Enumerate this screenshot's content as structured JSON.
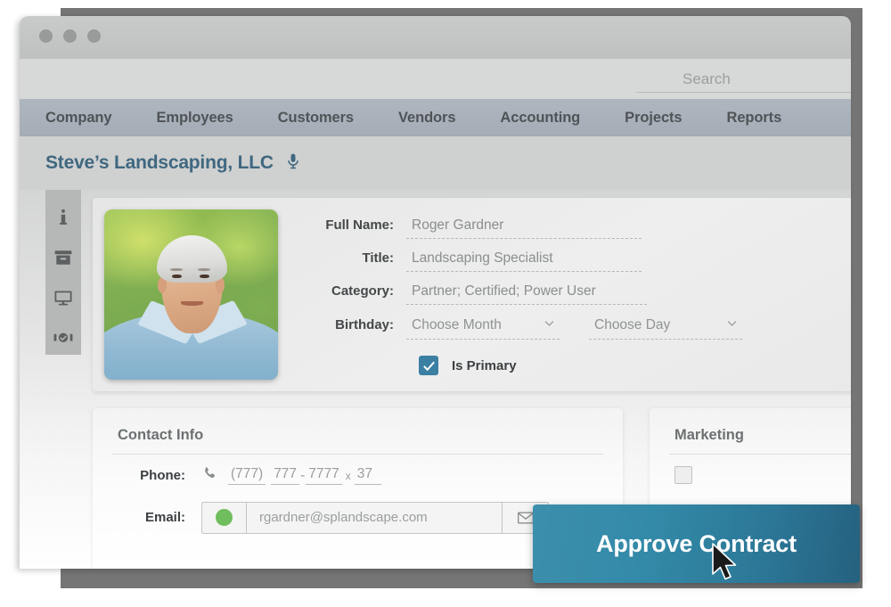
{
  "window": {
    "traffic_lights": [
      "close",
      "minimize",
      "maximize"
    ]
  },
  "search": {
    "placeholder": "Search",
    "value": "",
    "icon": "search-icon"
  },
  "nav": {
    "items": [
      {
        "label": "Company"
      },
      {
        "label": "Employees"
      },
      {
        "label": "Customers"
      },
      {
        "label": "Vendors"
      },
      {
        "label": "Accounting"
      },
      {
        "label": "Projects"
      },
      {
        "label": "Reports"
      }
    ]
  },
  "page": {
    "title": "Steve’s Landscaping, LLC",
    "title_icon": "microphone-icon"
  },
  "rail": {
    "items": [
      {
        "icon": "info-icon"
      },
      {
        "icon": "archive-box-icon"
      },
      {
        "icon": "monitor-icon"
      },
      {
        "icon": "handshake-icon"
      }
    ]
  },
  "profile": {
    "photo_alt": "portrait-photo",
    "fields": [
      {
        "label": "Full Name:",
        "value": "Roger Gardner"
      },
      {
        "label": "Title:",
        "value": "Landscaping Specialist"
      },
      {
        "label": "Category:",
        "value": "Partner; Certified; Power User"
      }
    ],
    "birthday": {
      "label": "Birthday:",
      "month": "Choose Month",
      "day": "Choose Day"
    },
    "is_primary": {
      "label": "Is Primary",
      "checked": true,
      "color": "#3b7fa3"
    }
  },
  "contact": {
    "title": "Contact Info",
    "phone": {
      "label": "Phone:",
      "icon": "phone-handset-icon",
      "area": "(777)",
      "prefix": "777",
      "separator": "-",
      "line": "7777",
      "ext_label": "x",
      "ext": "37"
    },
    "email": {
      "label": "Email:",
      "placeholder": "rgardner@splandscape.com",
      "value": "",
      "status_color": "#6fbd5c",
      "send_icon": "envelope-icon"
    }
  },
  "marketing": {
    "title": "Marketing"
  },
  "cta": {
    "label": "Approve Contract",
    "color_start": "#3c8fad",
    "color_end": "#25617f"
  },
  "cursor": {
    "type": "arrow-pointer"
  }
}
